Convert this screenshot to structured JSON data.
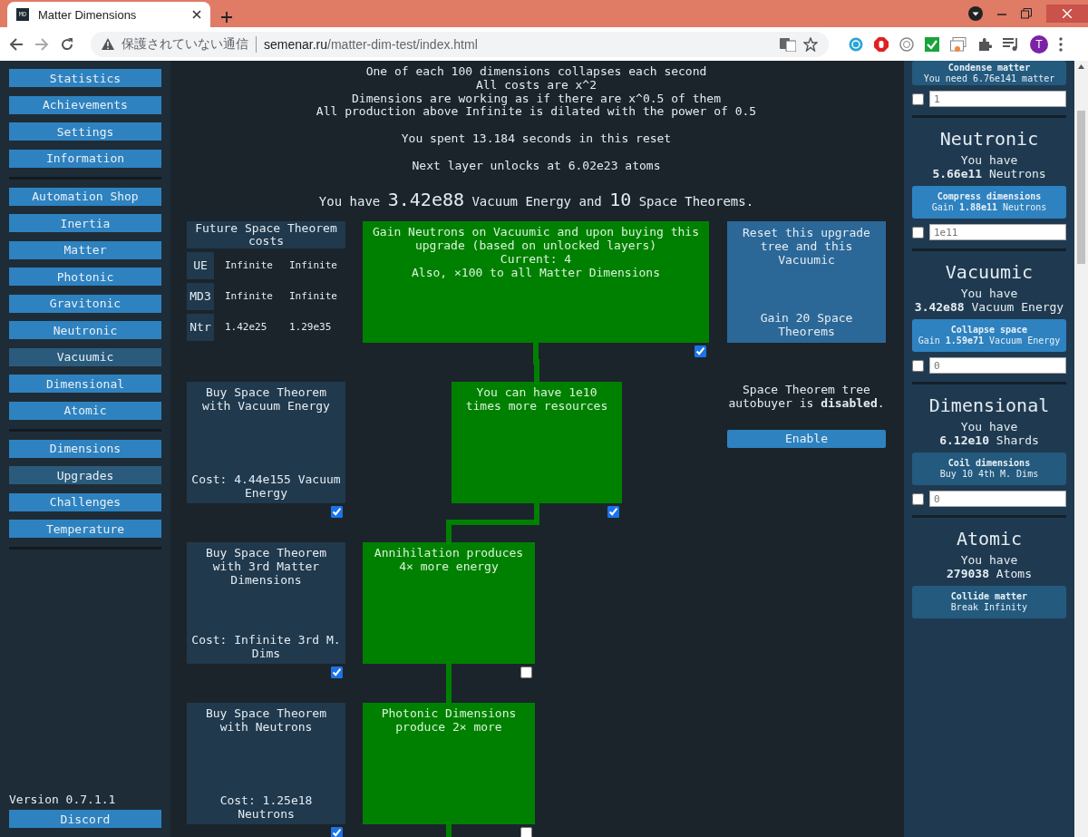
{
  "browser": {
    "tab_title": "Matter Dimensions",
    "favicon": "MD",
    "security_label": "保護されていない通信",
    "url_host": "semenar.ru",
    "url_path": "/matter-dim-test/index.html",
    "profile": "T"
  },
  "sidebar": {
    "groups": [
      [
        {
          "label": "Statistics",
          "selected": false
        },
        {
          "label": "Achievements",
          "selected": false
        },
        {
          "label": "Settings",
          "selected": false
        },
        {
          "label": "Information",
          "selected": false
        }
      ],
      [
        {
          "label": "Automation Shop",
          "selected": false
        },
        {
          "label": "Inertia",
          "selected": false
        },
        {
          "label": "Matter",
          "selected": false
        },
        {
          "label": "Photonic",
          "selected": false
        },
        {
          "label": "Gravitonic",
          "selected": false
        },
        {
          "label": "Neutronic",
          "selected": false
        },
        {
          "label": "Vacuumic",
          "selected": true
        },
        {
          "label": "Dimensional",
          "selected": false
        },
        {
          "label": "Atomic",
          "selected": false
        }
      ],
      [
        {
          "label": "Dimensions",
          "selected": false
        },
        {
          "label": "Upgrades",
          "selected": true
        },
        {
          "label": "Challenges",
          "selected": false
        },
        {
          "label": "Temperature",
          "selected": false
        }
      ]
    ],
    "version": "Version 0.7.1.1",
    "discord": "Discord"
  },
  "main": {
    "info_lines": [
      "One of each 100 dimensions collapses each second",
      "All costs are x^2",
      "Dimensions are working as if there are x^0.5 of them",
      "All production above Infinite is dilated with the power of 0.5"
    ],
    "time_spent": "You spent 13.184 seconds in this reset",
    "next_layer": "Next layer unlocks at 6.02e23 atoms",
    "summary": "You have **3.42e88** Vacuum Energy and **10** Space Theorems.",
    "cost_table": {
      "title": "Future Space Theorem costs",
      "rows": [
        {
          "label": "UE",
          "values": [
            "Infinite",
            "Infinite"
          ]
        },
        {
          "label": "MD3",
          "values": [
            "Infinite",
            "Infinite"
          ]
        },
        {
          "label": "Ntr",
          "values": [
            "1.42e25",
            "1.29e35"
          ]
        }
      ]
    },
    "tree": [
      {
        "kind": "wide",
        "lines": [
          "Gain Neutrons on Vacuumic and upon buying this upgrade (based on unlocked layers)",
          "Current: 4",
          "Also, ×100 to all Matter Dimensions"
        ],
        "checked": true
      },
      {
        "kind": "center",
        "lines": [
          "You can have 1e10 times more resources"
        ],
        "checked": true
      },
      {
        "kind": "left",
        "lines": [
          "Annihilation produces 4× more energy"
        ],
        "checked": false
      },
      {
        "kind": "left",
        "lines": [
          "Photonic Dimensions produce 2× more"
        ],
        "checked": false
      }
    ],
    "buy_boxes": [
      {
        "text": "Buy Space Theorem with Vacuum Energy",
        "cost": "Cost: 4.44e155 Vacuum Energy",
        "checked": true
      },
      {
        "text": "Buy Space Theorem with 3rd Matter Dimensions",
        "cost": "Cost: Infinite 3rd M. Dims",
        "checked": true
      },
      {
        "text": "Buy Space Theorem with Neutrons",
        "cost": "Cost: 1.25e18 Neutrons",
        "checked": true
      }
    ],
    "reset": {
      "text": "Reset this upgrade tree and this Vacuumic",
      "reward": "Gain 20 Space Theorems"
    },
    "autobuyer": {
      "text": "Space Theorem tree autobuyer is **disabled**.",
      "button": "Enable"
    }
  },
  "layers": {
    "top": {
      "button_title": "Condense matter",
      "button_sub": "You need 6.76e141 matter",
      "available": false,
      "checked": false,
      "placeholder": "1"
    },
    "sections": [
      {
        "name": "Neutronic",
        "have": "You have",
        "amount": "**5.66e11** Neutrons",
        "button_title": "Compress dimensions",
        "button_sub": "Gain **1.88e11** Neutrons",
        "available": true,
        "checked": false,
        "placeholder": "1e11"
      },
      {
        "name": "Vacuumic",
        "have": "You have",
        "amount": "**3.42e88** Vacuum Energy",
        "button_title": "Collapse space",
        "button_sub": "Gain **1.59e71** Vacuum Energy",
        "available": true,
        "checked": false,
        "placeholder": "0"
      },
      {
        "name": "Dimensional",
        "have": "You have",
        "amount": "**6.12e10** Shards",
        "button_title": "Coil dimensions",
        "button_sub": "Buy 10 4th M. Dims",
        "available": false,
        "checked": false,
        "placeholder": "0"
      },
      {
        "name": "Atomic",
        "have": "You have",
        "amount": "**279038** Atoms",
        "button_title": "Collide matter",
        "button_sub": "Break Infinity",
        "available": false
      }
    ]
  }
}
